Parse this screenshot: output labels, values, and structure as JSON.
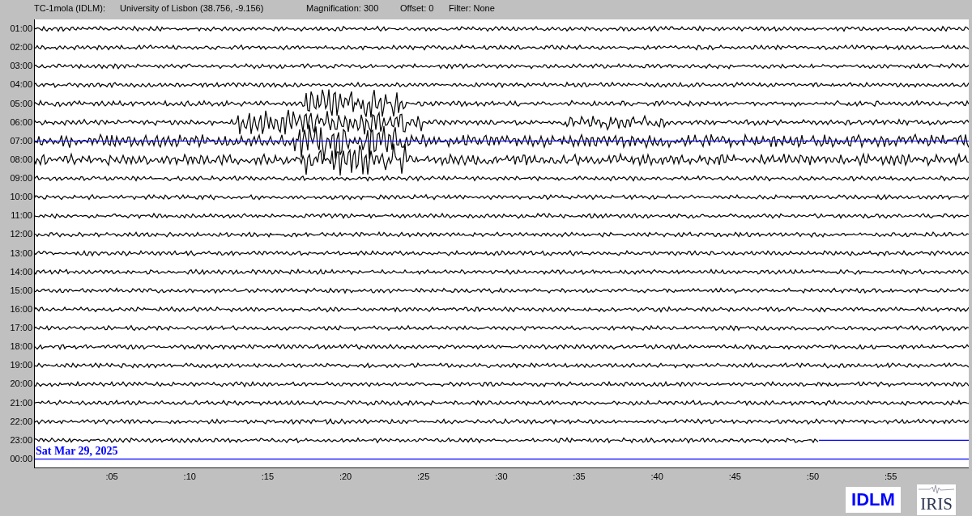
{
  "header": {
    "station": "TC-1mola (IDLM):",
    "location": "University of Lisbon (38.756, -9.156)",
    "magnification": "Magnification: 300",
    "offset": "Offset: 0",
    "filter": "Filter: None"
  },
  "rows": [
    {
      "label": "01:00",
      "kind": "trace"
    },
    {
      "label": "02:00",
      "kind": "trace"
    },
    {
      "label": "03:00",
      "kind": "trace"
    },
    {
      "label": "04:00",
      "kind": "trace"
    },
    {
      "label": "05:00",
      "kind": "trace"
    },
    {
      "label": "06:00",
      "kind": "trace"
    },
    {
      "label": "07:00",
      "kind": "trace"
    },
    {
      "label": "08:00",
      "kind": "trace"
    },
    {
      "label": "09:00",
      "kind": "trace"
    },
    {
      "label": "10:00",
      "kind": "trace"
    },
    {
      "label": "11:00",
      "kind": "trace"
    },
    {
      "label": "12:00",
      "kind": "trace"
    },
    {
      "label": "13:00",
      "kind": "trace"
    },
    {
      "label": "14:00",
      "kind": "trace"
    },
    {
      "label": "15:00",
      "kind": "trace"
    },
    {
      "label": "16:00",
      "kind": "trace"
    },
    {
      "label": "17:00",
      "kind": "trace"
    },
    {
      "label": "18:00",
      "kind": "trace"
    },
    {
      "label": "19:00",
      "kind": "trace"
    },
    {
      "label": "20:00",
      "kind": "trace"
    },
    {
      "label": "21:00",
      "kind": "trace"
    },
    {
      "label": "22:00",
      "kind": "trace"
    },
    {
      "label": "23:00",
      "kind": "partial"
    },
    {
      "label": "00:00",
      "kind": "empty"
    }
  ],
  "date": "Sat Mar 29, 2025",
  "x_ticks": [
    ":05",
    ":10",
    ":15",
    ":20",
    ":25",
    ":30",
    ":35",
    ":40",
    ":45",
    ":50",
    ":55"
  ],
  "logos": {
    "network": "IDLM",
    "iris": "IRIS"
  }
}
